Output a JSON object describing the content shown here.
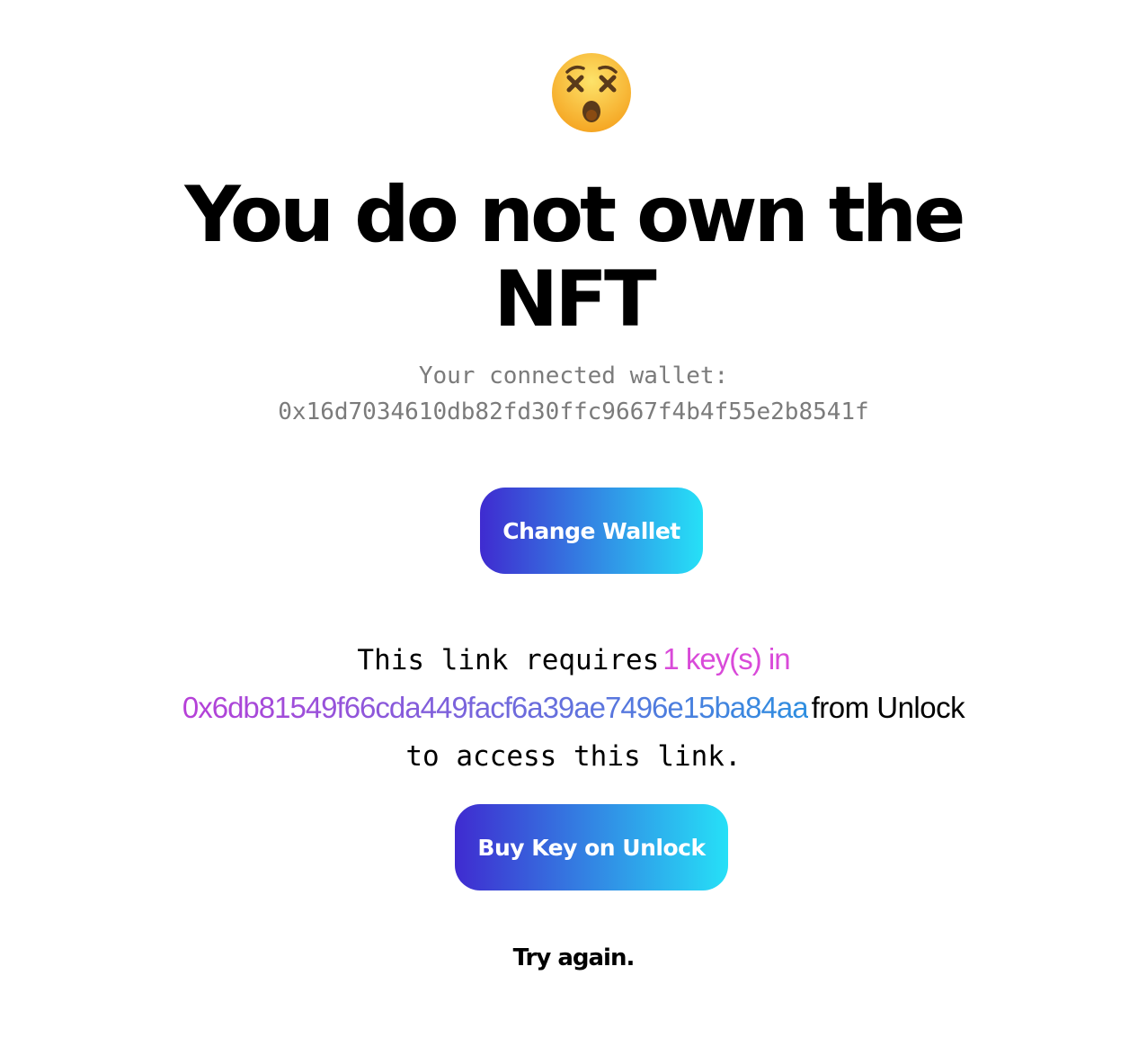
{
  "emoji": {
    "icon": "astonished-face-icon",
    "colors": {
      "face_top": "#fde36a",
      "face_bottom": "#f5a623",
      "features": "#5a3a1a",
      "mouth": "#8a4b12"
    }
  },
  "heading": {
    "line1": "You do not own the",
    "line2": "NFT"
  },
  "wallet": {
    "label": "Your connected wallet:",
    "address": "0x16d7034610db82fd30ffc9667f4b4f55e2b8541f"
  },
  "buttons": {
    "change_wallet": "Change Wallet",
    "buy_key": "Buy Key on Unlock"
  },
  "requirement": {
    "prefix": "This link requires",
    "keys": "1 key(s) in",
    "lock_address": "0x6db81549f66cda449facf6a39ae7496e15ba84aa",
    "from": "from Unlock",
    "suffix": "to access this link."
  },
  "try_again": "Try again.",
  "colors": {
    "gradient_start": "#3f2bd0",
    "gradient_end": "#26e0f7",
    "keys_color": "#d94ad9",
    "address_gradient_start": "#b73fd8",
    "address_gradient_end": "#2e8fe0",
    "wallet_text": "#7b7b7b"
  }
}
